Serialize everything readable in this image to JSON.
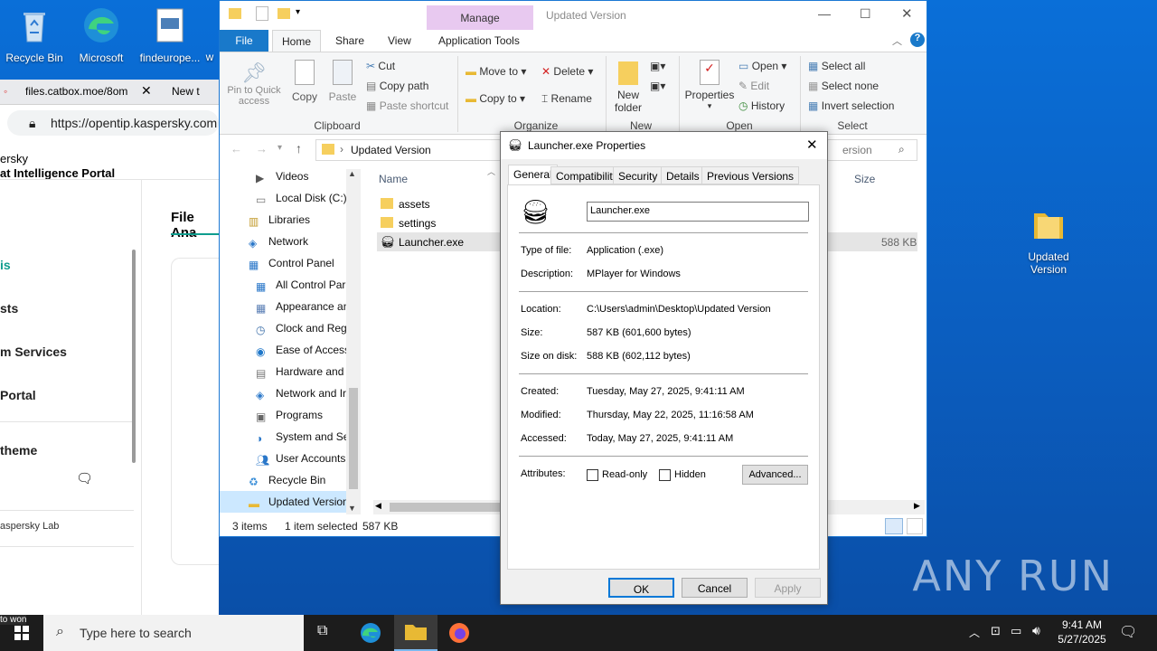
{
  "desktop": {
    "icons": [
      {
        "label": "Recycle Bin"
      },
      {
        "label": "Microsoft"
      },
      {
        "label": "findeurope..."
      },
      {
        "label": "w"
      }
    ],
    "right_icon": {
      "label_line1": "Updated",
      "label_line2": "Version"
    },
    "watermark": "ANY RUN"
  },
  "browser": {
    "tab1": "files.catbox.moe/8om",
    "tab2": "New t",
    "url": "https://opentip.kaspersky.com",
    "header_line1": "ersky",
    "header_line2": "at Intelligence Portal",
    "page_heading": "File Ana",
    "nav": [
      "is",
      "sts",
      "m Services",
      "Portal",
      "theme"
    ],
    "footer": "aspersky Lab"
  },
  "explorer": {
    "title": "Updated Version",
    "manage_tab": "Manage",
    "tabs": {
      "file": "File",
      "home": "Home",
      "share": "Share",
      "view": "View",
      "app_tools": "Application Tools"
    },
    "ribbon": {
      "pin": "Pin to Quick\naccess",
      "pin_line1": "Pin to Quick",
      "pin_line2": "access",
      "copy": "Copy",
      "paste": "Paste",
      "cut": "Cut",
      "copy_path": "Copy path",
      "paste_shortcut": "Paste shortcut",
      "clipboard": "Clipboard",
      "move_to": "Move to",
      "copy_to": "Copy to",
      "delete": "Delete",
      "rename": "Rename",
      "organize": "Organize",
      "new_folder_line1": "New",
      "new_folder_line2": "folder",
      "new": "New",
      "properties": "Properties",
      "open_btn": "Open",
      "edit": "Edit",
      "history": "History",
      "open_group": "Open",
      "select_all": "Select all",
      "select_none": "Select none",
      "invert_selection": "Invert selection",
      "select_group": "Select"
    },
    "path": "Updated Version",
    "search_placeholder": "ersion",
    "columns": {
      "name": "Name",
      "size": "Size"
    },
    "nav_items": [
      {
        "label": "Videos"
      },
      {
        "label": "Local Disk (C:)"
      },
      {
        "label": "Libraries"
      },
      {
        "label": "Network"
      },
      {
        "label": "Control Panel"
      },
      {
        "label": "All Control Par"
      },
      {
        "label": "Appearance an"
      },
      {
        "label": "Clock and Regi"
      },
      {
        "label": "Ease of Access"
      },
      {
        "label": "Hardware and"
      },
      {
        "label": "Network and Ir"
      },
      {
        "label": "Programs"
      },
      {
        "label": "System and Sec"
      },
      {
        "label": "User Accounts"
      },
      {
        "label": "Recycle Bin"
      },
      {
        "label": "Updated Version"
      }
    ],
    "files": [
      {
        "name": "assets",
        "size": ""
      },
      {
        "name": "settings",
        "size": ""
      },
      {
        "name": "Launcher.exe",
        "size": "588 KB"
      }
    ],
    "status": {
      "count": "3 items",
      "selected": "1 item selected",
      "size": "587 KB"
    }
  },
  "props": {
    "title": "Launcher.exe Properties",
    "tabs": [
      "General",
      "Compatibility",
      "Security",
      "Details",
      "Previous Versions"
    ],
    "filename": "Launcher.exe",
    "rows": {
      "type_label": "Type of file:",
      "type_value": "Application (.exe)",
      "desc_label": "Description:",
      "desc_value": "MPlayer for Windows",
      "loc_label": "Location:",
      "loc_value": "C:\\Users\\admin\\Desktop\\Updated Version",
      "size_label": "Size:",
      "size_value": "587 KB (601,600 bytes)",
      "disk_label": "Size on disk:",
      "disk_value": "588 KB (602,112 bytes)",
      "created_label": "Created:",
      "created_value": "Tuesday, May 27, 2025, 9:41:11 AM",
      "modified_label": "Modified:",
      "modified_value": "Thursday, May 22, 2025, 11:16:58 AM",
      "accessed_label": "Accessed:",
      "accessed_value": "Today, May 27, 2025, 9:41:11 AM",
      "attr_label": "Attributes:"
    },
    "readonly": "Read-only",
    "hidden": "Hidden",
    "advanced": "Advanced...",
    "ok": "OK",
    "cancel": "Cancel",
    "apply": "Apply"
  },
  "taskbar": {
    "search_placeholder": "Type here to search",
    "time": "9:41 AM",
    "date": "5/27/2025",
    "left_fragment": "to won"
  },
  "colors": {
    "accent": "#1979ca",
    "selection": "#cce8ff",
    "manage": "#e8c9f0"
  }
}
